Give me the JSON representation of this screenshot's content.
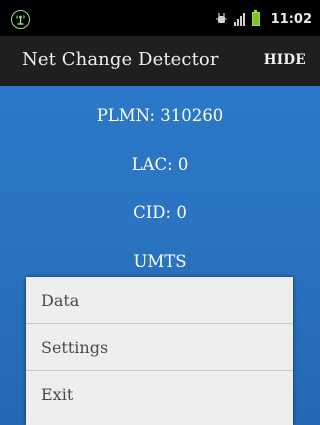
{
  "status_bar": {
    "time": "11:02",
    "icons": [
      "app-notification-icon",
      "usb-debug-icon",
      "signal-icon",
      "battery-charging-icon"
    ],
    "colors": {
      "app_icon": "#9be07a",
      "battery": "#7fc12a"
    }
  },
  "action_bar": {
    "title": "Net Change Detector",
    "action_label": "HIDE",
    "background": "#1f1f1f"
  },
  "content": {
    "background": "#2a74c2",
    "lines": [
      "PLMN: 310260",
      "LAC: 0",
      "CID: 0",
      "UMTS"
    ]
  },
  "menu": {
    "items": [
      "Data",
      "Settings",
      "Exit"
    ]
  }
}
